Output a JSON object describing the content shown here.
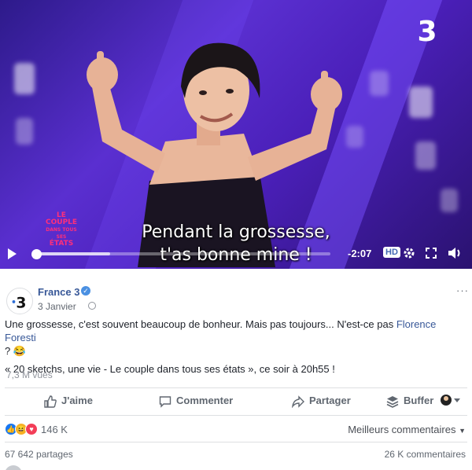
{
  "video": {
    "subtitle_line1": "Pendant la grossesse,",
    "subtitle_line2": "t'as bonne mine !",
    "channel_logo": "3",
    "show_logo_lines": [
      "LE",
      "COUPLE",
      "DANS TOUS",
      "SES",
      "ÉTATS"
    ],
    "time_remaining": "-2:07",
    "quality_badge": "HD",
    "progress": 0.0,
    "buffered": 0.25,
    "icons": [
      "play-icon",
      "gear-icon",
      "fullscreen-icon",
      "volume-icon"
    ]
  },
  "post": {
    "page_name": "France 3",
    "verified": true,
    "date": "3 Janvier",
    "privacy_icon": "globe-icon",
    "more_label": "···",
    "text_line1_before_link": "Une grossesse, c'est souvent beaucoup de bonheur. Mais pas toujours... N'est-ce pas ",
    "text_link": "Florence Foresti",
    "text_line1_after_link": " ?",
    "text_emoji": "😂",
    "text_line2": "« 20 sketchs, une vie - Le couple dans tous ses états », ce soir à 20h55 !",
    "views": "7,3 M vues"
  },
  "actions": {
    "like": "J'aime",
    "comment": "Commenter",
    "share": "Partager",
    "buffer": "Buffer"
  },
  "stats": {
    "reaction_count": "146 K",
    "sort_label": "Meilleurs commentaires",
    "shares": "67 642 partages",
    "comments": "26 K commentaires"
  },
  "colors": {
    "link": "#385898",
    "video_bg": "#4a1fb8",
    "like_blue": "#1877f2",
    "love_red": "#f33e58",
    "haha_yellow": "#f7b125"
  }
}
